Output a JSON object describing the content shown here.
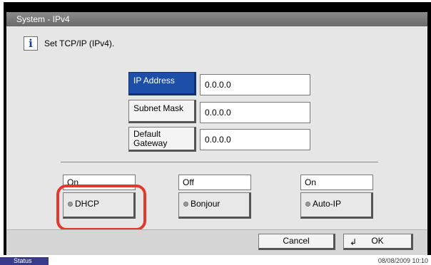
{
  "window": {
    "title": "System - IPv4"
  },
  "info": {
    "icon": "info-icon",
    "glyph": "i",
    "message": "Set TCP/IP (IPv4)."
  },
  "fields": [
    {
      "label": "IP Address",
      "value": "0.0.0.0",
      "selected": true
    },
    {
      "label": "Subnet Mask",
      "value": "0.0.0.0",
      "selected": false
    },
    {
      "label": "Default Gateway",
      "value": "0.0.0.0",
      "selected": false
    }
  ],
  "options": [
    {
      "state": "On",
      "label": "DHCP",
      "highlighted": true
    },
    {
      "state": "Off",
      "label": "Bonjour",
      "highlighted": false
    },
    {
      "state": "On",
      "label": "Auto-IP",
      "highlighted": false
    }
  ],
  "actions": {
    "cancel_label": "Cancel",
    "ok_label": "OK",
    "ok_icon": "enter-icon"
  },
  "status": {
    "button_label": "Status",
    "datetime": "08/08/2009   10:10"
  },
  "colors": {
    "selected": "#1d4ea8",
    "highlight": "#e0392f",
    "titlebar": "#7a7a7a"
  }
}
